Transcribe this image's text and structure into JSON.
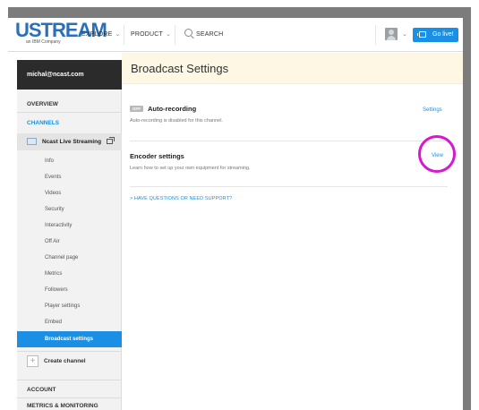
{
  "brand": {
    "logo_text": "USTREAM",
    "logo_subtext": "an IBM Company"
  },
  "topnav": {
    "explore_label": "EXPLORE",
    "product_label": "PRODUCT",
    "search_label": "SEARCH",
    "golive_label": "Go live!"
  },
  "sidebar": {
    "account_email": "michal@ncast.com",
    "overview_label": "OVERVIEW",
    "channels_label": "CHANNELS",
    "channel_name": "Ncast Live Streaming",
    "items": [
      {
        "label": "Info"
      },
      {
        "label": "Events"
      },
      {
        "label": "Videos"
      },
      {
        "label": "Security"
      },
      {
        "label": "Interactivity"
      },
      {
        "label": "Off Air"
      },
      {
        "label": "Channel page"
      },
      {
        "label": "Metrics"
      },
      {
        "label": "Followers"
      },
      {
        "label": "Player settings"
      },
      {
        "label": "Embed"
      },
      {
        "label": "Broadcast settings"
      }
    ],
    "create_channel_label": "Create channel",
    "account_label": "ACCOUNT",
    "metrics_label": "METRICS & MONITORING"
  },
  "main": {
    "title": "Broadcast Settings",
    "auto_recording": {
      "badge": "OFF",
      "title": "Auto-recording",
      "description": "Auto-recording is disabled for this channel.",
      "link": "Settings"
    },
    "encoder": {
      "title": "Encoder settings",
      "description": "Learn how to set up your own equipment for streaming.",
      "link": "View"
    },
    "support_link": "HAVE QUESTIONS OR NEED SUPPORT?"
  },
  "colors": {
    "accent": "#1a8fe3",
    "header_bg": "#fdf7e4",
    "sidebar_dark": "#2b2b2b",
    "highlight": "#d619d0"
  }
}
